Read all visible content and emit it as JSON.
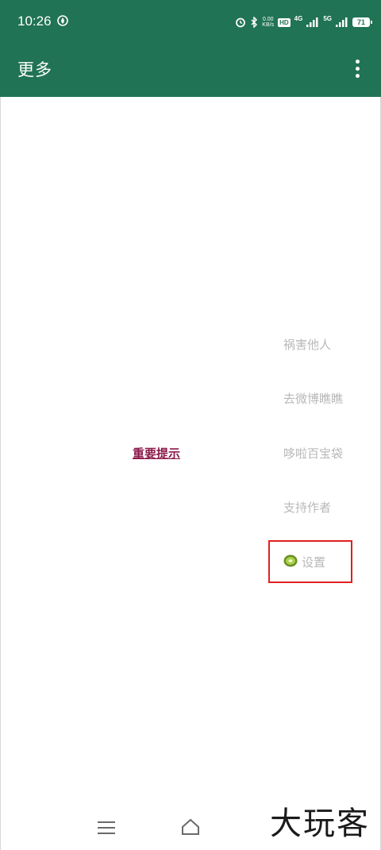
{
  "status_bar": {
    "time": "10:26",
    "speed_value": "0.00",
    "speed_unit": "KB/s",
    "hd_label": "HD",
    "network_1": "4G",
    "network_2": "5G",
    "battery": "71"
  },
  "app_bar": {
    "title": "更多",
    "overflow_icon": "more-vert-icon"
  },
  "main": {
    "notice_link": "重要提示",
    "menu_items": [
      {
        "label": "祸害他人"
      },
      {
        "label": "去微博瞧瞧"
      },
      {
        "label": "哆啦百宝袋"
      },
      {
        "label": "支持作者"
      }
    ],
    "settings": {
      "label": "设置",
      "icon": "kiwi-icon"
    },
    "highlight_color": "#e02020"
  },
  "colors": {
    "toolbar": "#217356",
    "notice_text": "#8b1a4a",
    "menu_text": "#b8b8b8"
  },
  "watermark": "大玩客"
}
